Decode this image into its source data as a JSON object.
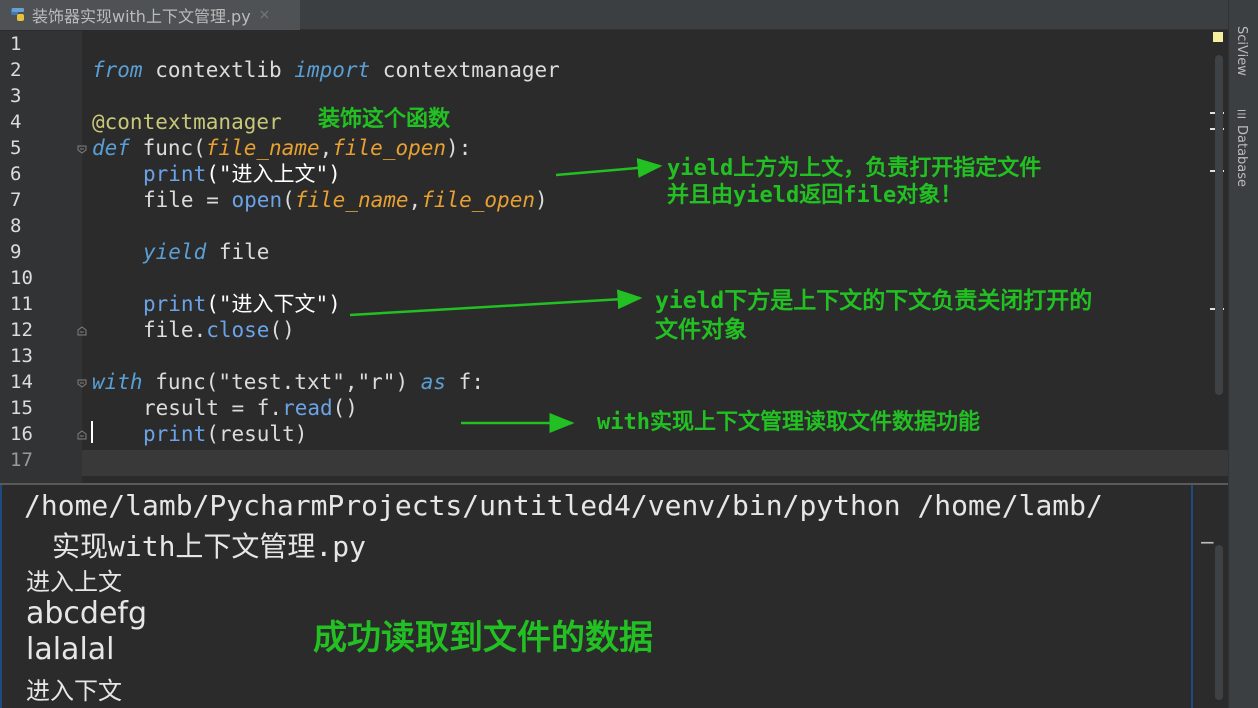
{
  "tab": {
    "icon": "python-file-icon",
    "title": "装饰器实现with上下文管理.py",
    "close": "×"
  },
  "right_tools": {
    "sciview": "SciView",
    "database": "Database"
  },
  "editor": {
    "line_numbers": [
      "1",
      "2",
      "3",
      "4",
      "5",
      "6",
      "7",
      "8",
      "9",
      "10",
      "11",
      "12",
      "13",
      "14",
      "15",
      "16",
      "17"
    ],
    "code": {
      "l2": {
        "kw1": "from",
        "mod": " contextlib ",
        "kw2": "import",
        "name": " contextmanager"
      },
      "l4": {
        "deco": "@contextmanager"
      },
      "l5": {
        "kw": "def",
        "fn": " func(",
        "p1": "file_name",
        "comma": ",",
        "p2": "file_open",
        "close": "):"
      },
      "l6": {
        "bi": "print",
        "rest": "(\"进入上文\")"
      },
      "l7": {
        "pre": "file = ",
        "bi": "open",
        "open_paren": "(",
        "p1": "file_name",
        "comma": ",",
        "p2": "file_open",
        "close": ")"
      },
      "l9": {
        "kw": "yield",
        "rest": " file"
      },
      "l11": {
        "bi": "print",
        "rest": "(\"进入下文\")"
      },
      "l12": {
        "pre": "file.",
        "bi": "close",
        "rest": "()"
      },
      "l14": {
        "kw": "with",
        "mid": " func(\"test.txt\",\"r\") ",
        "kw2": "as",
        "rest": " f:"
      },
      "l15": {
        "pre": "result = f.",
        "bi": "read",
        "rest": "()"
      },
      "l16": {
        "bi": "print",
        "rest": "(result)"
      }
    }
  },
  "annotations": {
    "decorate": "装饰这个函数",
    "upper_1": "yield上方为上文，负责打开指定文件",
    "upper_2": "并且由yield返回file对象！",
    "lower_1": "yield下方是上下文的下文负责关闭打开的",
    "lower_2": "文件对象",
    "with_note": "with实现上下文管理读取文件数据功能",
    "success": "成功读取到文件的数据",
    "arrow_color": "#22c022"
  },
  "console": {
    "path_line_1": "/home/lamb/PycharmProjects/untitled4/venv/bin/python /home/lamb/",
    "path_line_2": "实现with上下文管理.py",
    "output": [
      "进入上文",
      "abcdefg",
      "lalalal",
      "进入下文"
    ],
    "minimize": "−"
  }
}
